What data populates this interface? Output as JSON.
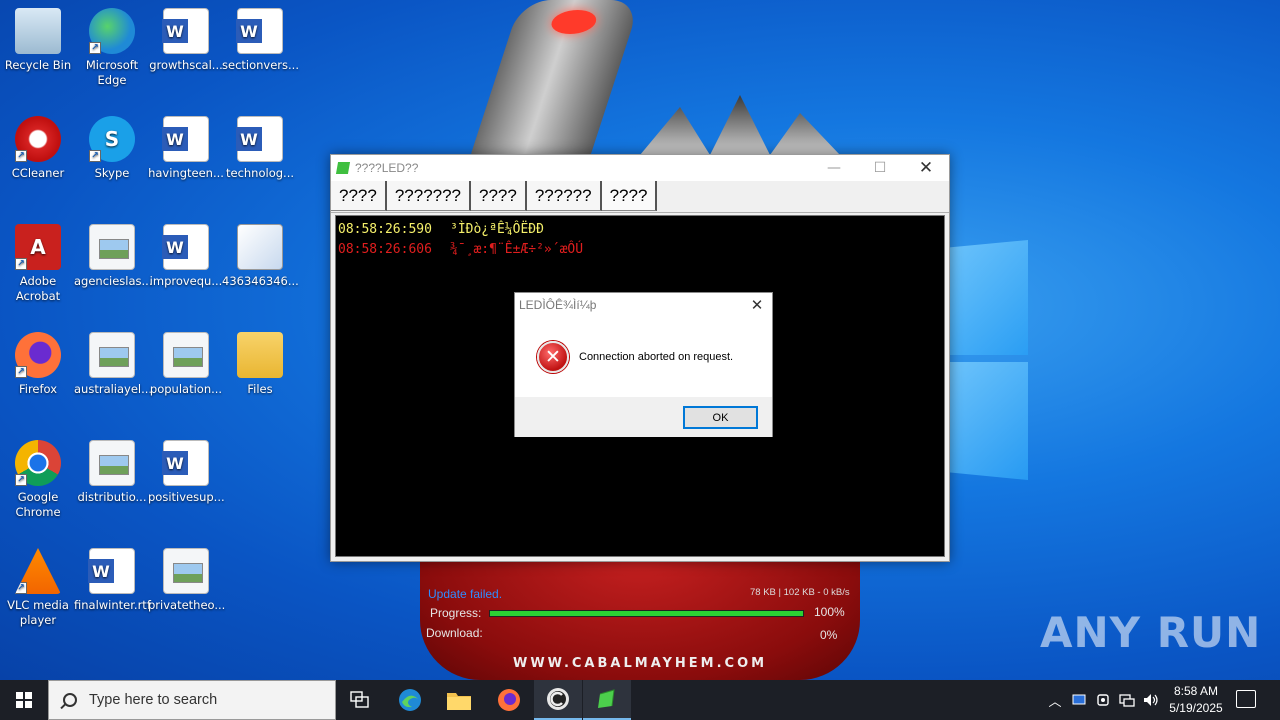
{
  "desktop": {
    "icons": [
      {
        "label": "Recycle Bin",
        "icon": "recycle-bin-icon"
      },
      {
        "label": "Microsoft Edge",
        "icon": "edge-icon"
      },
      {
        "label": "growthscal...",
        "icon": "word-doc-icon"
      },
      {
        "label": "sectionvers...",
        "icon": "word-doc-icon"
      },
      {
        "label": "CCleaner",
        "icon": "ccleaner-icon"
      },
      {
        "label": "Skype",
        "icon": "skype-icon"
      },
      {
        "label": "havingteen...",
        "icon": "word-doc-icon"
      },
      {
        "label": "technolog...",
        "icon": "word-doc-icon"
      },
      {
        "label": "Adobe Acrobat",
        "icon": "acrobat-icon"
      },
      {
        "label": "agencieslas...",
        "icon": "image-file-icon"
      },
      {
        "label": "improvequ...",
        "icon": "word-doc-icon"
      },
      {
        "label": "436346346...",
        "icon": "installer-icon"
      },
      {
        "label": "Firefox",
        "icon": "firefox-icon"
      },
      {
        "label": "australiayel...",
        "icon": "image-file-icon"
      },
      {
        "label": "population...",
        "icon": "image-file-icon"
      },
      {
        "label": "Files",
        "icon": "folder-icon"
      },
      {
        "label": "Google Chrome",
        "icon": "chrome-icon"
      },
      {
        "label": "distributio...",
        "icon": "image-file-icon"
      },
      {
        "label": "positivesup...",
        "icon": "word-doc-icon"
      },
      {
        "label": "VLC media player",
        "icon": "vlc-icon"
      },
      {
        "label": "finalwinter.rtf",
        "icon": "word-doc-icon"
      },
      {
        "label": "privatetheo...",
        "icon": "image-file-icon"
      }
    ],
    "watermark": "ANY RUN"
  },
  "launcher": {
    "status": "Update failed.",
    "stats": "78 KB | 102 KB - 0 kB/s",
    "progress_label": "Progress:",
    "progress_value": "100%",
    "progress_fraction": 1.0,
    "download_label": "Download:",
    "download_value": "0%",
    "url": "WWW.CABALMAYHEM.COM"
  },
  "app": {
    "title": "????LED??",
    "tabs": [
      "????",
      "???????",
      "????",
      "??????",
      "????"
    ],
    "log": [
      {
        "time": "08:58:26:590",
        "text": "³ÌÐò¿ªÊ¼ÔËÐÐ",
        "color": "#f5f06a"
      },
      {
        "time": "08:58:26:606",
        "text": "¾¯¸æ:¶¨Ê±Æ÷²»´æÔÚ",
        "color": "#e01e1e"
      }
    ]
  },
  "dialog": {
    "title": "LEDÌÔÊ¾Ìí¼þ",
    "message": "Connection aborted on request.",
    "ok_label": "OK"
  },
  "taskbar": {
    "search_placeholder": "Type here to search",
    "time": "8:58 AM",
    "date": "5/19/2025"
  }
}
